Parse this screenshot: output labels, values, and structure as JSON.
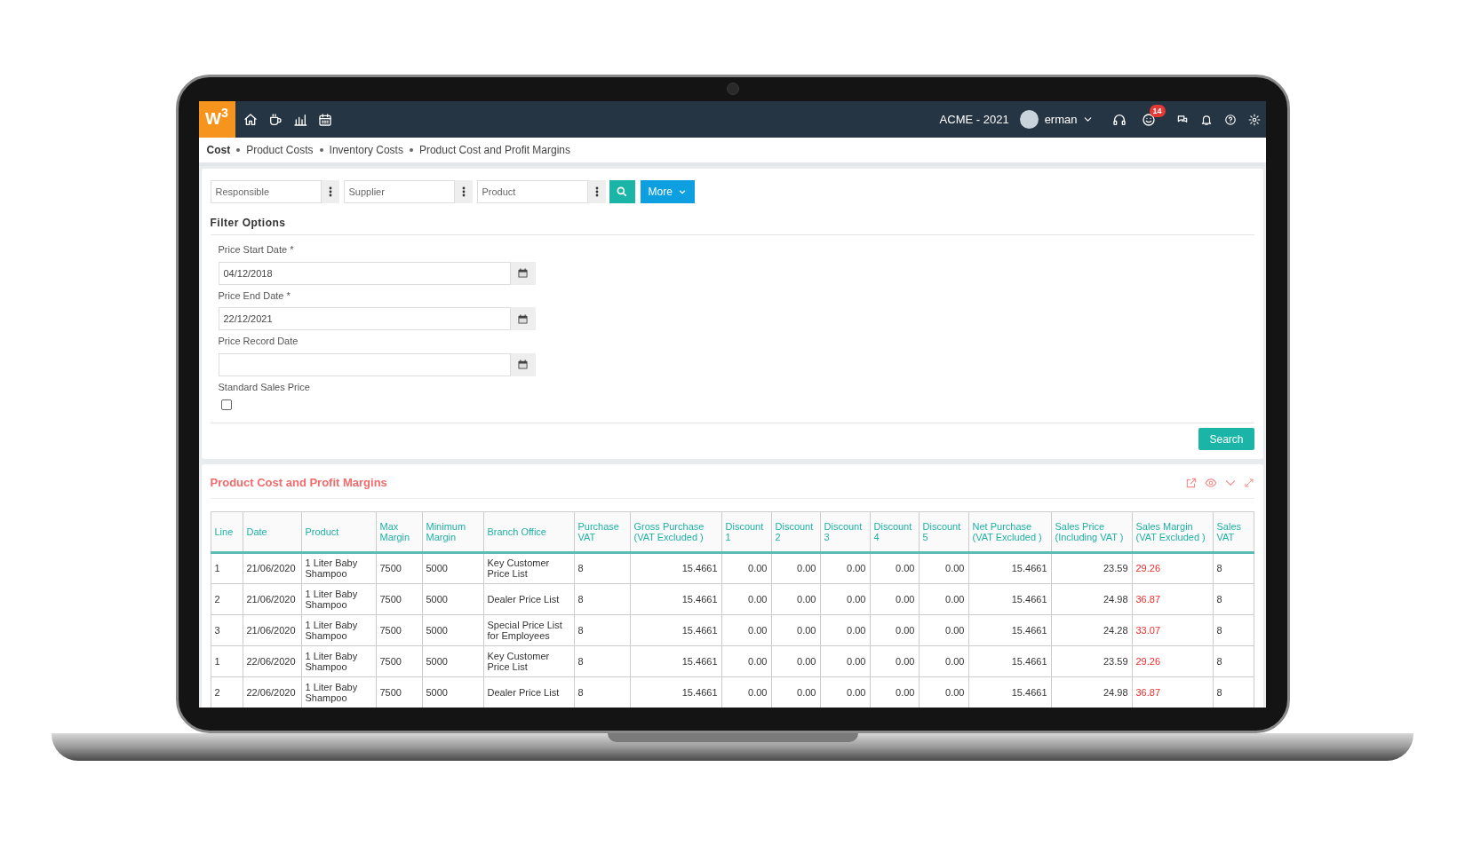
{
  "topbar": {
    "logo": "W$^{3}$",
    "company": "ACME - 2021",
    "user": "erman",
    "notification_badge": "14"
  },
  "breadcrumb": [
    {
      "label": "Cost",
      "kind": "root"
    },
    {
      "label": "Product Costs",
      "kind": "link"
    },
    {
      "label": "Inventory Costs",
      "kind": "link"
    },
    {
      "label": "Product Cost and Profit Margins",
      "kind": "link"
    }
  ],
  "lookup_fields": [
    {
      "placeholder": "Responsible"
    },
    {
      "placeholder": "Supplier"
    },
    {
      "placeholder": "Product"
    }
  ],
  "more_button": "More",
  "filter_options": {
    "title": "Filter Options",
    "date_fields": [
      {
        "label": "Price Start Date *",
        "value": "04/12/2018"
      },
      {
        "label": "Price End Date *",
        "value": "22/12/2021"
      },
      {
        "label": "Price Record Date"
      }
    ],
    "checkbox": {
      "label": "Standard Sales Price",
      "checked": false
    },
    "search_button": "Search"
  },
  "results": {
    "title": "Product Cost and Profit Margins",
    "table": {
      "columns": [
        {
          "label": "Line",
          "kind": "text"
        },
        {
          "label": "Date",
          "kind": "text"
        },
        {
          "label": "Product",
          "kind": "text"
        },
        {
          "label": "Max Margin",
          "kind": "text"
        },
        {
          "label": "Minimum Margin",
          "kind": "text"
        },
        {
          "label": "Branch Office",
          "kind": "text"
        },
        {
          "label": "Purchase VAT",
          "kind": "text"
        },
        {
          "label": "Gross Purchase (VAT Excluded )",
          "kind": "number"
        },
        {
          "label": "Discount 1",
          "kind": "number"
        },
        {
          "label": "Discount 2",
          "kind": "number"
        },
        {
          "label": "Discount 3",
          "kind": "number"
        },
        {
          "label": "Discount 4",
          "kind": "number"
        },
        {
          "label": "Discount 5",
          "kind": "number"
        },
        {
          "label": "Net Purchase (VAT Excluded )",
          "kind": "number"
        },
        {
          "label": "Sales Price (Including VAT )",
          "kind": "number"
        },
        {
          "label": "Sales Margin (VAT Excluded )",
          "kind": "alert"
        },
        {
          "label": "Sales VAT",
          "kind": "text"
        }
      ],
      "rows": [
        {
          "cells": [
            "1",
            "21/06/2020",
            "1 Liter Baby Shampoo",
            "7500",
            "5000",
            "Key Customer Price List",
            "8",
            "15.4661",
            "0.00",
            "0.00",
            "0.00",
            "0.00",
            "0.00",
            "15.4661",
            "23.59",
            "29.26",
            "8"
          ]
        },
        {
          "cells": [
            "2",
            "21/06/2020",
            "1 Liter Baby Shampoo",
            "7500",
            "5000",
            "Dealer Price List",
            "8",
            "15.4661",
            "0.00",
            "0.00",
            "0.00",
            "0.00",
            "0.00",
            "15.4661",
            "24.98",
            "36.87",
            "8"
          ]
        },
        {
          "cells": [
            "3",
            "21/06/2020",
            "1 Liter Baby Shampoo",
            "7500",
            "5000",
            "Special Price List for Employees",
            "8",
            "15.4661",
            "0.00",
            "0.00",
            "0.00",
            "0.00",
            "0.00",
            "15.4661",
            "24.28",
            "33.07",
            "8"
          ]
        },
        {
          "cells": [
            "1",
            "22/06/2020",
            "1 Liter Baby Shampoo",
            "7500",
            "5000",
            "Key Customer Price List",
            "8",
            "15.4661",
            "0.00",
            "0.00",
            "0.00",
            "0.00",
            "0.00",
            "15.4661",
            "23.59",
            "29.26",
            "8"
          ]
        },
        {
          "cells": [
            "2",
            "22/06/2020",
            "1 Liter Baby Shampoo",
            "7500",
            "5000",
            "Dealer Price List",
            "8",
            "15.4661",
            "0.00",
            "0.00",
            "0.00",
            "0.00",
            "0.00",
            "15.4661",
            "24.98",
            "36.87",
            "8"
          ]
        }
      ]
    }
  }
}
